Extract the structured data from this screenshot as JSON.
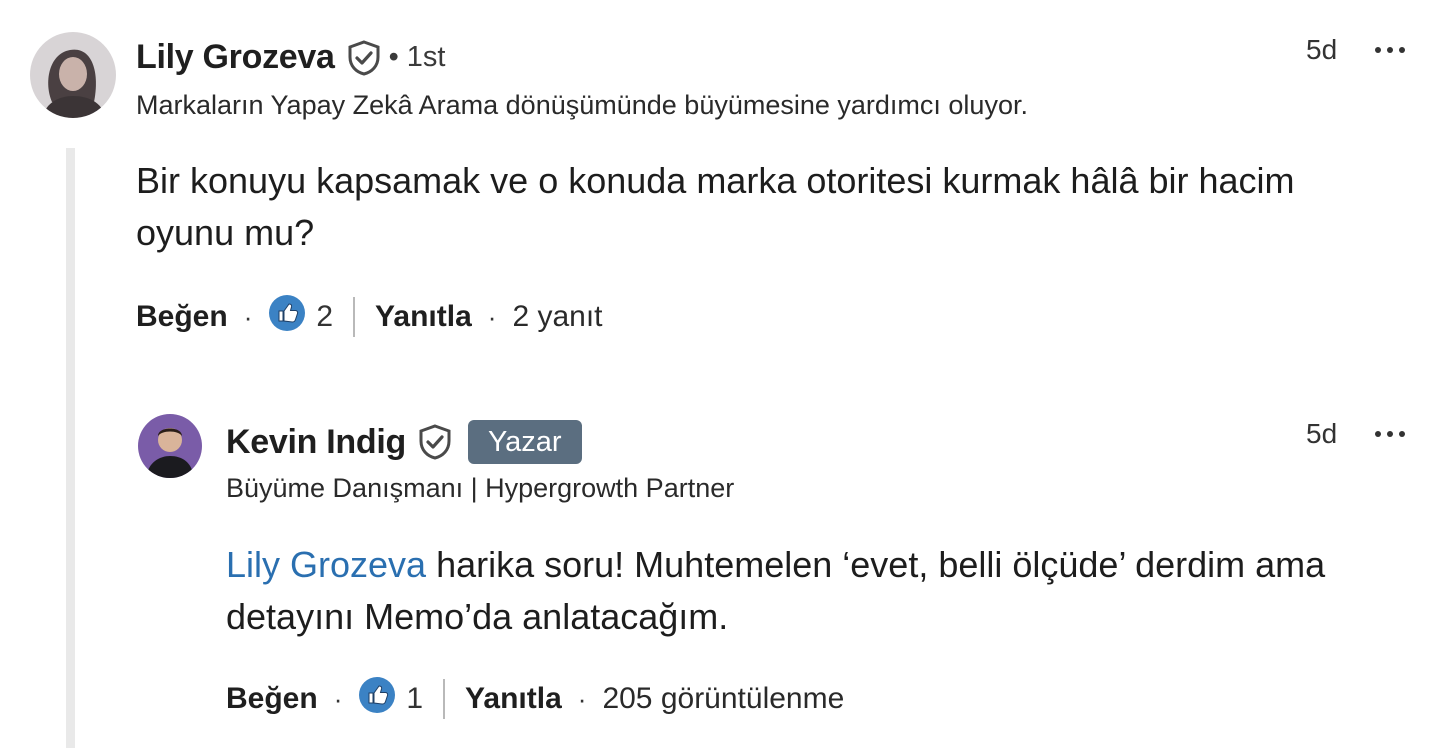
{
  "comment": {
    "author": "Lily Grozeva",
    "connection": "• 1st",
    "headline": "Markaların Yapay Zekâ Arama dönüşümünde büyümesine yardımcı oluyor.",
    "time": "5d",
    "text": "Bir konuyu kapsamak ve o konuda marka otoritesi kurmak hâlâ bir hacim oyunu mu?",
    "like_label": "Beğen",
    "reaction_count": "2",
    "reply_label": "Yanıtla",
    "replies_count": "2 yanıt"
  },
  "reply": {
    "author": "Kevin Indig",
    "badge": "Yazar",
    "headline": "Büyüme Danışmanı | Hypergrowth Partner",
    "time": "5d",
    "mention": "Lily Grozeva",
    "text": " harika soru! Muhtemelen ‘evet, belli ölçüde’ derdim ama detayını Memo’da anlatacağım.",
    "like_label": "Beğen",
    "reaction_count": "1",
    "reply_label": "Yanıtla",
    "views": "205 görüntülenme"
  },
  "colors": {
    "mention": "#2a6fb0",
    "badge_bg": "#5b6e80",
    "like_icon": "#3b82c4",
    "thread_line": "#e9e9e9"
  },
  "icons": {
    "verified": "shield-check-icon",
    "more": "ellipsis-icon",
    "like": "thumbs-up-reaction-icon"
  }
}
